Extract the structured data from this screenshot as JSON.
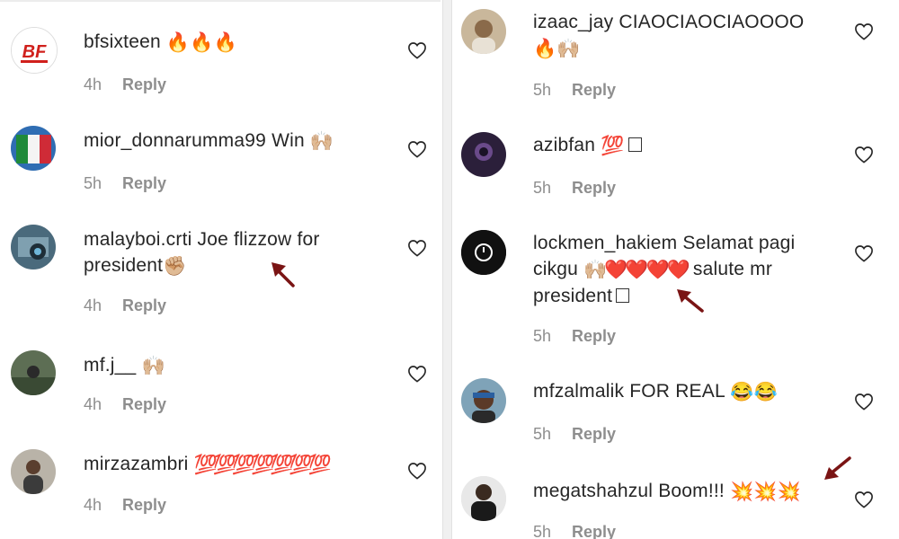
{
  "left": {
    "comments": [
      {
        "username": "bfsixteen",
        "text": "",
        "emoji": "🔥🔥🔥",
        "time": "4h",
        "reply": "Reply"
      },
      {
        "username": "mior_donnarumma99",
        "text": "Win",
        "emoji": "🙌🏼",
        "time": "5h",
        "reply": "Reply"
      },
      {
        "username": "malayboi.crti",
        "text": "Joe flizzow for",
        "line2": "president",
        "emoji": "✊🏼",
        "time": "4h",
        "reply": "Reply"
      },
      {
        "username": "mf.j__",
        "text": "",
        "emoji": "🙌🏼",
        "time": "4h",
        "reply": "Reply"
      },
      {
        "username": "mirzazambri",
        "text": "",
        "emoji": "💯💯💯💯💯💯💯",
        "time": "4h",
        "reply": "Reply"
      }
    ]
  },
  "right": {
    "comments": [
      {
        "username": "izaac_jay",
        "text": "CIAOCIAOCIAOOOO",
        "line2_emoji": "🔥🙌🏼",
        "time": "5h",
        "reply": "Reply"
      },
      {
        "username": "azibfan",
        "text": "",
        "emoji": "💯",
        "time": "5h",
        "reply": "Reply"
      },
      {
        "username": "lockmen_hakiem",
        "text": "Selamat pagi",
        "line2": "cikgu",
        "line2_emoji": "🙌🏼❤️❤️❤️❤️",
        "line2_tail": "salute mr",
        "line3": "president",
        "time": "5h",
        "reply": "Reply"
      },
      {
        "username": "mfzalmalik",
        "text": "FOR REAL",
        "emoji": "😂😂",
        "time": "5h",
        "reply": "Reply"
      },
      {
        "username": "megatshahzul",
        "text": "Boom!!!",
        "emoji": "💥💥💥",
        "time": "5h",
        "reply": "Reply"
      }
    ]
  },
  "colors": {
    "text": "#262626",
    "meta": "#8e8e8e",
    "arrow": "#7a1414"
  },
  "icons": {
    "like": "heart-outline-icon",
    "annotation": "arrow-pointer-icon"
  }
}
